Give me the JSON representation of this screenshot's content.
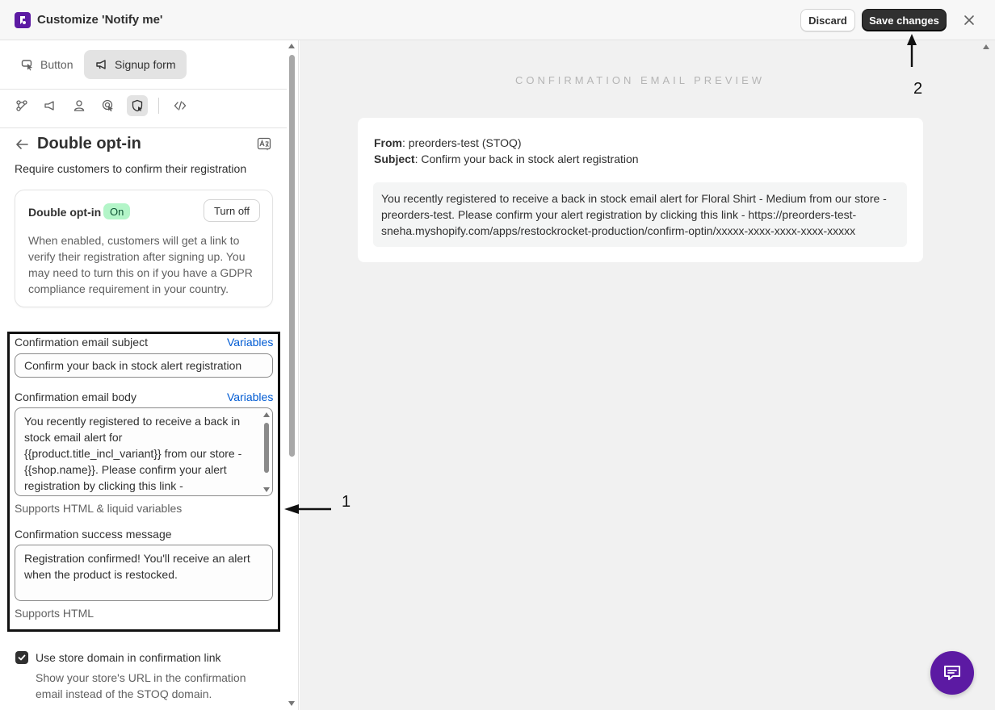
{
  "header": {
    "title": "Customize 'Notify me'",
    "discard_label": "Discard",
    "save_label": "Save changes"
  },
  "tabs": {
    "button_label": "Button",
    "signup_label": "Signup form",
    "active": "Signup form"
  },
  "icon_toolbar": [
    "fields-icon",
    "button-style-icon",
    "customer-icon",
    "target-icon",
    "double-optin-icon",
    "code-icon"
  ],
  "section": {
    "title": "Double opt-in",
    "description": "Require customers to confirm their registration"
  },
  "optin_card": {
    "label": "Double opt-in",
    "status": "On",
    "turn_off_label": "Turn off",
    "description": "When enabled, customers will get a link to verify their registration after signing up. You may need to turn this on if you have a GDPR compliance requirement in your country."
  },
  "fields": {
    "subject_label": "Confirmation email subject",
    "subject_value": "Confirm your back in stock alert registration",
    "variables_label": "Variables",
    "body_label": "Confirmation email body",
    "body_value": "You recently registered to receive a back in stock email alert for {{product.title_incl_variant}} from our store - {{shop.name}}. Please confirm your alert registration by clicking this link -",
    "body_help": "Supports HTML & liquid variables",
    "success_label": "Confirmation success message",
    "success_value": "Registration confirmed! You'll receive an alert when the product is restocked.",
    "success_help": "Supports HTML"
  },
  "store_domain": {
    "checked": true,
    "label": "Use store domain in confirmation link",
    "help": "Show your store's URL in the confirmation email instead of the STOQ domain."
  },
  "preview": {
    "heading": "CONFIRMATION EMAIL PREVIEW",
    "from_label": "From",
    "from_value": ": preorders-test (STOQ)",
    "subject_label": "Subject",
    "subject_value": ": Confirm your back in stock alert registration",
    "body": "You recently registered to receive a back in stock email alert for Floral Shirt - Medium from our store - preorders-test. Please confirm your alert registration by clicking this link - https://preorders-test-sneha.myshopify.com/apps/restockrocket-production/confirm-optin/xxxxx-xxxx-xxxx-xxxx-xxxxx"
  },
  "annotations": {
    "one": "1",
    "two": "2"
  },
  "colors": {
    "brand": "#5c1aa3",
    "primary_button": "#303030",
    "link": "#005bd3",
    "badge_on_bg": "#b3f5c8"
  }
}
